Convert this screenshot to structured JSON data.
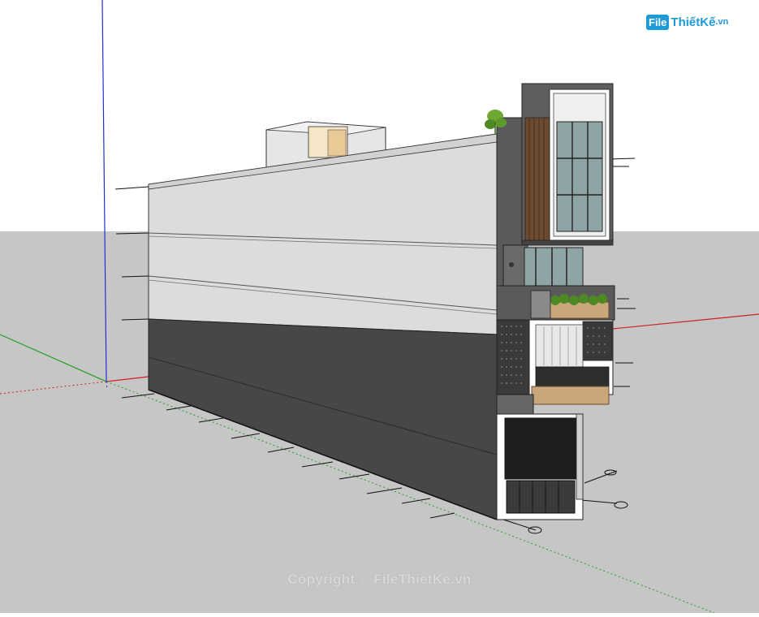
{
  "watermark": {
    "logo_box": "File",
    "logo_text": "ThiếtKế",
    "logo_suffix": ".vn",
    "copyright": "Copyright © FileThietKe.vn"
  },
  "colors": {
    "sky": "#ffffff",
    "ground": "#c8c8c8",
    "wall_light": "#dcdcdc",
    "wall_dark": "#4a4a4a",
    "frame": "#5c5c5c",
    "glass": "#8fa5a5",
    "axis_red": "#d02020",
    "axis_green": "#20a020",
    "axis_blue": "#2030d0",
    "wood": "#c9a77a",
    "brand": "#1e9ad6"
  },
  "icons": [
    "plant-icon",
    "section-marker-icon"
  ]
}
